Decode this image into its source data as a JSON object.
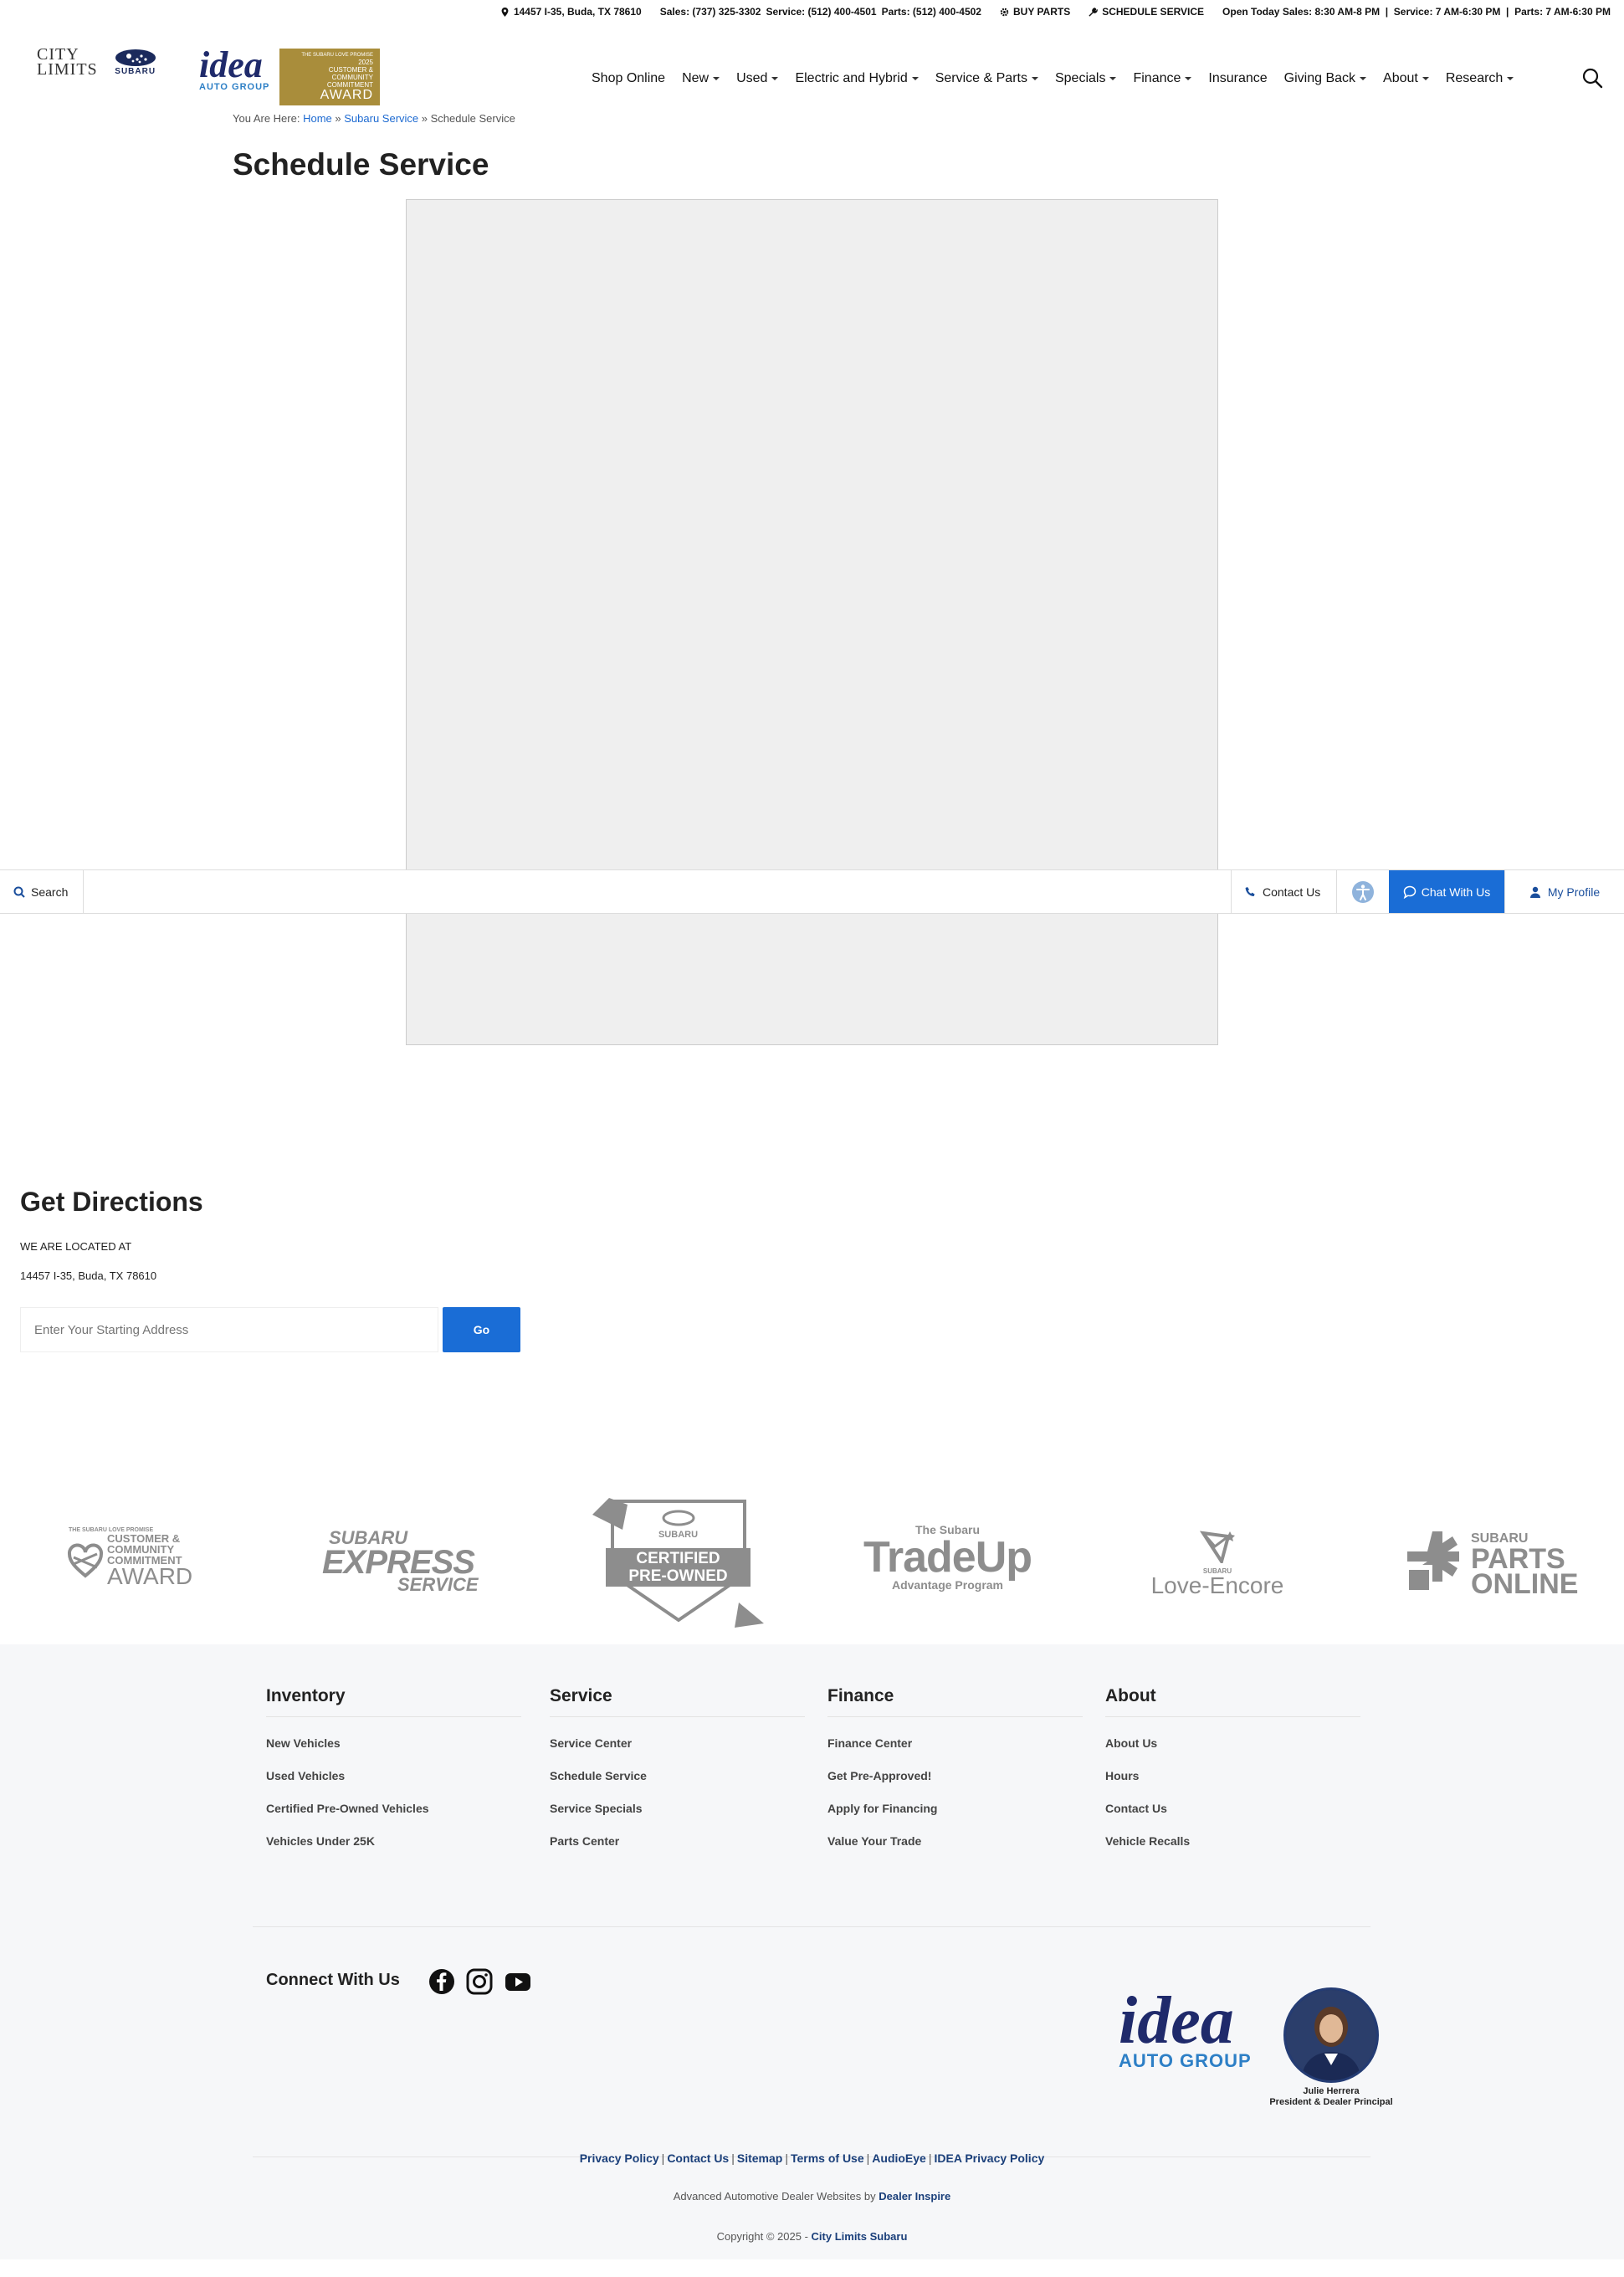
{
  "topbar": {
    "address": "14457 I-35, Buda, TX 78610",
    "sales": "Sales: (737) 325-3302",
    "service": "Service: (512) 400-4501",
    "parts": "Parts: (512) 400-4502",
    "buy_parts": "BUY PARTS",
    "schedule_service": "SCHEDULE SERVICE",
    "hours": "Open Today Sales: 8:30 AM-8 PM  |  Service: 7 AM-6:30 PM  |  Parts: 7 AM-6:30 PM"
  },
  "header": {
    "logo_city": "CITY",
    "logo_limits": "LIMITS",
    "logo_subaru": "SUBARU",
    "logo_idea": "idea",
    "logo_idea_sub": "AUTO GROUP",
    "award_top": "THE SUBARU LOVE PROMISE",
    "award_year": "2025",
    "award_mid": "CUSTOMER & COMMUNITY COMMITMENT",
    "award_big": "AWARD",
    "nav": [
      {
        "label": "Shop Online",
        "dropdown": false
      },
      {
        "label": "New",
        "dropdown": true
      },
      {
        "label": "Used",
        "dropdown": true
      },
      {
        "label": "Electric and Hybrid",
        "dropdown": true
      },
      {
        "label": "Service & Parts",
        "dropdown": true
      },
      {
        "label": "Specials",
        "dropdown": true
      },
      {
        "label": "Finance",
        "dropdown": true
      },
      {
        "label": "Insurance",
        "dropdown": false
      },
      {
        "label": "Giving Back",
        "dropdown": true
      },
      {
        "label": "About",
        "dropdown": true
      },
      {
        "label": "Research",
        "dropdown": true
      }
    ]
  },
  "breadcrumb": {
    "prefix": "You Are Here:",
    "home": "Home",
    "sep": "»",
    "parent": "Subaru Service",
    "current": "Schedule Service"
  },
  "page": {
    "title": "Schedule Service"
  },
  "stickybar": {
    "search": "Search",
    "contact": "Contact Us",
    "chat": "Chat With Us",
    "profile": "My Profile"
  },
  "directions": {
    "title": "Get Directions",
    "subtitle": "WE ARE LOCATED AT",
    "address": "14457 I-35, Buda, TX 78610",
    "placeholder": "Enter Your Starting Address",
    "go": "Go"
  },
  "brands": {
    "award_small": "THE SUBARU LOVE PROMISE",
    "award_mid": "CUSTOMER & COMMUNITY COMMITMENT",
    "award_big": "AWARD",
    "express_1": "SUBARU",
    "express_2": "EXPRESS",
    "express_3": "SERVICE",
    "cpo_brand": "SUBARU",
    "cpo_1": "CERTIFIED",
    "cpo_2": "PRE-OWNED",
    "tradeup_top": "The Subaru",
    "tradeup_big": "TradeUp",
    "tradeup_sub": "Advantage Program",
    "encore_small": "SUBARU",
    "encore_big": "Love-Encore",
    "parts_1": "SUBARU",
    "parts_2": "PARTS",
    "parts_3": "ONLINE"
  },
  "footer": {
    "columns": [
      {
        "title": "Inventory",
        "links": [
          "New Vehicles",
          "Used Vehicles",
          "Certified Pre-Owned Vehicles",
          "Vehicles Under 25K"
        ]
      },
      {
        "title": "Service",
        "links": [
          "Service Center",
          "Schedule Service",
          "Service Specials",
          "Parts Center"
        ]
      },
      {
        "title": "Finance",
        "links": [
          "Finance Center",
          "Get Pre-Approved!",
          "Apply for Financing",
          "Value Your Trade"
        ]
      },
      {
        "title": "About",
        "links": [
          "About Us",
          "Hours",
          "Contact Us",
          "Vehicle Recalls"
        ]
      }
    ],
    "connect": "Connect With Us",
    "idea": "idea",
    "idea_sub": "AUTO GROUP",
    "person_name": "Julie Herrera",
    "person_title": "President & Dealer Principal",
    "links": [
      "Privacy Policy",
      "Contact Us",
      "Sitemap",
      "Terms of Use",
      "AudioEye",
      "IDEA Privacy Policy"
    ],
    "powered_prefix": "Advanced Automotive Dealer Websites by",
    "powered_name": "Dealer Inspire",
    "copyright_prefix": "Copyright © 2025 -",
    "copyright_name": "City Limits Subaru"
  },
  "colors": {
    "accent_blue": "#1a6dd6",
    "link_blue": "#1d6ad1",
    "award_gold": "#a98d3b",
    "idea_navy": "#1f2a6b"
  }
}
